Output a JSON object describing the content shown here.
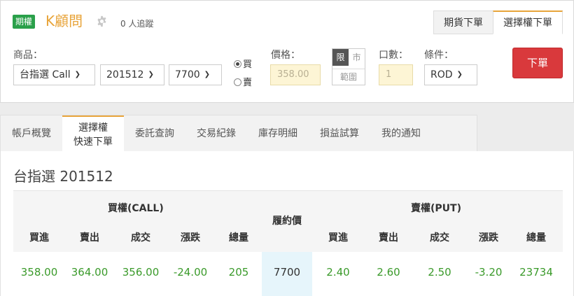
{
  "header": {
    "badge": "期權",
    "brand": "K顧問",
    "follow_text": "0 人追蹤",
    "tabs": [
      "期貨下單",
      "選擇權下單"
    ],
    "active_tab": "選擇權下單"
  },
  "order_form": {
    "product_label": "商品：",
    "product": "台指選 Call",
    "month": "201512",
    "strike": "7700",
    "side_options": [
      "買",
      "賣"
    ],
    "side_selected": "買",
    "price_label": "價格：",
    "price_placeholder": "358.00",
    "price_type_options": [
      "限",
      "市"
    ],
    "price_type_selected": "限",
    "range_label": "範圍",
    "qty_label": "口數：",
    "qty_placeholder": "1",
    "cond_label": "條件：",
    "cond": "ROD",
    "submit_label": "下單"
  },
  "nav_tabs": [
    {
      "line1": "帳戶概覽"
    },
    {
      "line1": "選擇權",
      "line2": "快速下單",
      "active": true
    },
    {
      "line1": "委託查詢"
    },
    {
      "line1": "交易紀錄"
    },
    {
      "line1": "庫存明細"
    },
    {
      "line1": "損益試算"
    },
    {
      "line1": "我的通知"
    }
  ],
  "quote_table": {
    "title": "台指選 201512",
    "call_label": "買權(CALL)",
    "put_label": "賣權(PUT)",
    "strike_label": "履約價",
    "columns": [
      "買進",
      "賣出",
      "成交",
      "漲跌",
      "總量"
    ],
    "row": {
      "call": [
        "358.00",
        "364.00",
        "356.00",
        "-24.00",
        "205"
      ],
      "strike": "7700",
      "put": [
        "2.40",
        "2.60",
        "2.50",
        "-3.20",
        "23734"
      ]
    }
  },
  "colors": {
    "accent": "#e8a43a",
    "badge_green": "#2aa04a",
    "submit_red": "#d9393c",
    "value_green": "#3a9a2a",
    "strike_bg": "#e6f5fb"
  }
}
